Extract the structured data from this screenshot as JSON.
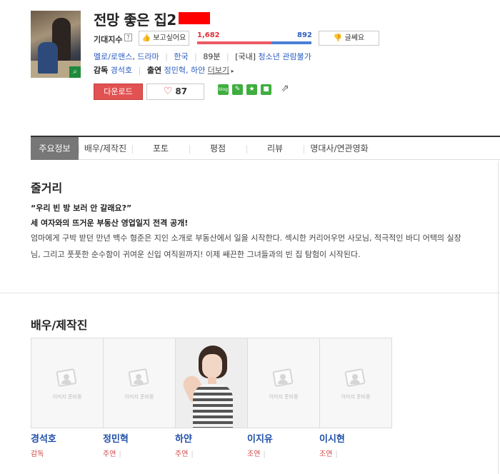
{
  "movie": {
    "title": "전망 좋은 집2",
    "poster_zoom_icon": "search-icon"
  },
  "expectation": {
    "label": "기대지수",
    "help": "?",
    "want_label": "보고싶어요",
    "want_icon": "thumbs-up-icon",
    "want_count": "1,682",
    "nah_count": "892",
    "nah_label": "글쎄요",
    "nah_icon": "thumbs-down-icon",
    "want_ratio": 0.653
  },
  "meta": {
    "genre1": "멜로/로맨스",
    "genre2": "드라마",
    "country": "한국",
    "runtime": "89분",
    "rating_prefix": "[국내]",
    "rating": "청소년 관람불가"
  },
  "credits": {
    "director_label": "감독",
    "director": "경석호",
    "cast_label": "출연",
    "cast_list": "정민혁, 하얀",
    "more": "더보기"
  },
  "actions": {
    "download": "다운로드",
    "like_count": "87",
    "share_icons": [
      {
        "name": "blog-share-icon",
        "label": "blog",
        "color": "#3fae3f"
      },
      {
        "name": "me2day-share-icon",
        "label": "✎",
        "color": "#3fae3f"
      },
      {
        "name": "star-share-icon",
        "label": "★",
        "color": "#3fae3f"
      },
      {
        "name": "box-share-icon",
        "label": "■",
        "color": "#3fae3f"
      }
    ]
  },
  "tabs": [
    "주요정보",
    "배우/제작진",
    "포토",
    "평점",
    "리뷰",
    "명대사/연관영화"
  ],
  "synopsis": {
    "heading": "줄거리",
    "quote": "“우리 빈 방 보러 안 갈래요?”",
    "tagline": "세 여자와의 뜨거운 부동산 영업일지 전격 공개!",
    "body": "엄마에게 구박 받던 만년 백수 형준은 지인 소개로 부동산에서 일을 시작한다. 섹시한 커리어우먼 사모님, 적극적인 바디 어택의 실장님, 그리고 풋풋한 순수함이 귀여운 신입 여직원까지! 이제 쌔끈한 그녀들과의 빈 집 탐험이 시작된다."
  },
  "cast_section": {
    "heading": "배우/제작진",
    "placeholder_text": "이미지 준비중",
    "people": [
      {
        "name": "경석호",
        "role": "감독",
        "has_photo": false
      },
      {
        "name": "정민혁",
        "role": "주연",
        "has_photo": false
      },
      {
        "name": "하얀",
        "role": "주연",
        "has_photo": true
      },
      {
        "name": "이지유",
        "role": "조연",
        "has_photo": false
      },
      {
        "name": "이시현",
        "role": "조연",
        "has_photo": false
      }
    ]
  },
  "colors": {
    "accent_red": "#e35252",
    "link_blue": "#2d5dbf",
    "cast_name_blue": "#1f4ea8",
    "tab_active": "#777777"
  }
}
